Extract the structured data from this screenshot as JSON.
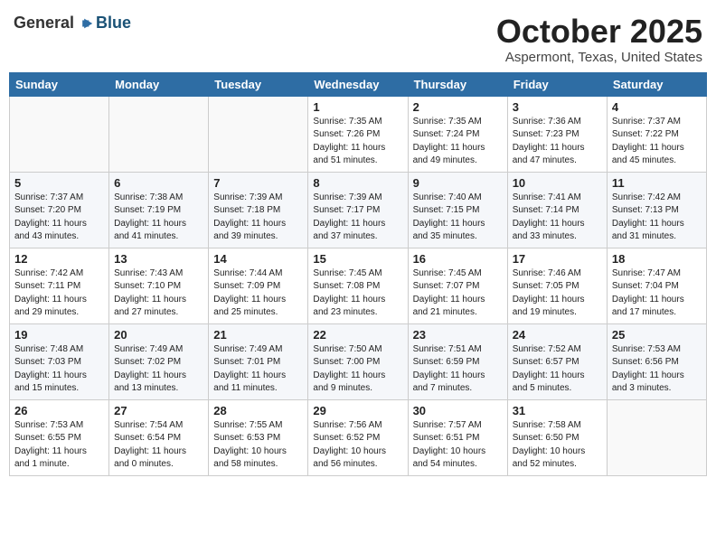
{
  "header": {
    "logo_general": "General",
    "logo_blue": "Blue",
    "month_title": "October 2025",
    "location": "Aspermont, Texas, United States"
  },
  "calendar": {
    "days_of_week": [
      "Sunday",
      "Monday",
      "Tuesday",
      "Wednesday",
      "Thursday",
      "Friday",
      "Saturday"
    ],
    "weeks": [
      [
        {
          "day": "",
          "info": ""
        },
        {
          "day": "",
          "info": ""
        },
        {
          "day": "",
          "info": ""
        },
        {
          "day": "1",
          "info": "Sunrise: 7:35 AM\nSunset: 7:26 PM\nDaylight: 11 hours\nand 51 minutes."
        },
        {
          "day": "2",
          "info": "Sunrise: 7:35 AM\nSunset: 7:24 PM\nDaylight: 11 hours\nand 49 minutes."
        },
        {
          "day": "3",
          "info": "Sunrise: 7:36 AM\nSunset: 7:23 PM\nDaylight: 11 hours\nand 47 minutes."
        },
        {
          "day": "4",
          "info": "Sunrise: 7:37 AM\nSunset: 7:22 PM\nDaylight: 11 hours\nand 45 minutes."
        }
      ],
      [
        {
          "day": "5",
          "info": "Sunrise: 7:37 AM\nSunset: 7:20 PM\nDaylight: 11 hours\nand 43 minutes."
        },
        {
          "day": "6",
          "info": "Sunrise: 7:38 AM\nSunset: 7:19 PM\nDaylight: 11 hours\nand 41 minutes."
        },
        {
          "day": "7",
          "info": "Sunrise: 7:39 AM\nSunset: 7:18 PM\nDaylight: 11 hours\nand 39 minutes."
        },
        {
          "day": "8",
          "info": "Sunrise: 7:39 AM\nSunset: 7:17 PM\nDaylight: 11 hours\nand 37 minutes."
        },
        {
          "day": "9",
          "info": "Sunrise: 7:40 AM\nSunset: 7:15 PM\nDaylight: 11 hours\nand 35 minutes."
        },
        {
          "day": "10",
          "info": "Sunrise: 7:41 AM\nSunset: 7:14 PM\nDaylight: 11 hours\nand 33 minutes."
        },
        {
          "day": "11",
          "info": "Sunrise: 7:42 AM\nSunset: 7:13 PM\nDaylight: 11 hours\nand 31 minutes."
        }
      ],
      [
        {
          "day": "12",
          "info": "Sunrise: 7:42 AM\nSunset: 7:11 PM\nDaylight: 11 hours\nand 29 minutes."
        },
        {
          "day": "13",
          "info": "Sunrise: 7:43 AM\nSunset: 7:10 PM\nDaylight: 11 hours\nand 27 minutes."
        },
        {
          "day": "14",
          "info": "Sunrise: 7:44 AM\nSunset: 7:09 PM\nDaylight: 11 hours\nand 25 minutes."
        },
        {
          "day": "15",
          "info": "Sunrise: 7:45 AM\nSunset: 7:08 PM\nDaylight: 11 hours\nand 23 minutes."
        },
        {
          "day": "16",
          "info": "Sunrise: 7:45 AM\nSunset: 7:07 PM\nDaylight: 11 hours\nand 21 minutes."
        },
        {
          "day": "17",
          "info": "Sunrise: 7:46 AM\nSunset: 7:05 PM\nDaylight: 11 hours\nand 19 minutes."
        },
        {
          "day": "18",
          "info": "Sunrise: 7:47 AM\nSunset: 7:04 PM\nDaylight: 11 hours\nand 17 minutes."
        }
      ],
      [
        {
          "day": "19",
          "info": "Sunrise: 7:48 AM\nSunset: 7:03 PM\nDaylight: 11 hours\nand 15 minutes."
        },
        {
          "day": "20",
          "info": "Sunrise: 7:49 AM\nSunset: 7:02 PM\nDaylight: 11 hours\nand 13 minutes."
        },
        {
          "day": "21",
          "info": "Sunrise: 7:49 AM\nSunset: 7:01 PM\nDaylight: 11 hours\nand 11 minutes."
        },
        {
          "day": "22",
          "info": "Sunrise: 7:50 AM\nSunset: 7:00 PM\nDaylight: 11 hours\nand 9 minutes."
        },
        {
          "day": "23",
          "info": "Sunrise: 7:51 AM\nSunset: 6:59 PM\nDaylight: 11 hours\nand 7 minutes."
        },
        {
          "day": "24",
          "info": "Sunrise: 7:52 AM\nSunset: 6:57 PM\nDaylight: 11 hours\nand 5 minutes."
        },
        {
          "day": "25",
          "info": "Sunrise: 7:53 AM\nSunset: 6:56 PM\nDaylight: 11 hours\nand 3 minutes."
        }
      ],
      [
        {
          "day": "26",
          "info": "Sunrise: 7:53 AM\nSunset: 6:55 PM\nDaylight: 11 hours\nand 1 minute."
        },
        {
          "day": "27",
          "info": "Sunrise: 7:54 AM\nSunset: 6:54 PM\nDaylight: 11 hours\nand 0 minutes."
        },
        {
          "day": "28",
          "info": "Sunrise: 7:55 AM\nSunset: 6:53 PM\nDaylight: 10 hours\nand 58 minutes."
        },
        {
          "day": "29",
          "info": "Sunrise: 7:56 AM\nSunset: 6:52 PM\nDaylight: 10 hours\nand 56 minutes."
        },
        {
          "day": "30",
          "info": "Sunrise: 7:57 AM\nSunset: 6:51 PM\nDaylight: 10 hours\nand 54 minutes."
        },
        {
          "day": "31",
          "info": "Sunrise: 7:58 AM\nSunset: 6:50 PM\nDaylight: 10 hours\nand 52 minutes."
        },
        {
          "day": "",
          "info": ""
        }
      ]
    ]
  }
}
